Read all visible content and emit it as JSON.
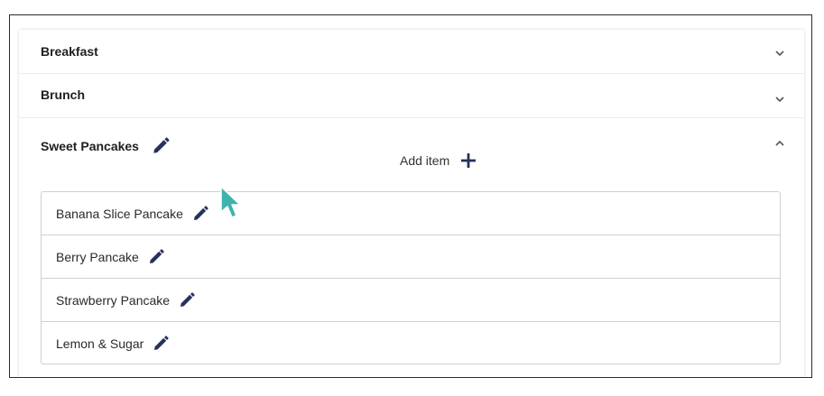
{
  "accordion": {
    "panels": [
      {
        "title": "Breakfast",
        "expanded": false
      },
      {
        "title": "Brunch",
        "expanded": false
      },
      {
        "title": "Sweet Pancakes",
        "expanded": true
      }
    ],
    "add_item_label": "Add item",
    "items": [
      {
        "label": "Banana Slice Pancake"
      },
      {
        "label": "Berry Pancake"
      },
      {
        "label": "Strawberry Pancake"
      },
      {
        "label": "Lemon & Sugar"
      }
    ]
  },
  "icons": {
    "edit": "pencil-icon",
    "add": "plus-icon",
    "collapse": "chevron-up-icon",
    "expand": "chevron-down-icon",
    "cursor": "mouse-pointer-icon"
  },
  "colors": {
    "icon_navy": "#26315e",
    "cursor_teal": "#3fb3ad",
    "text": "#212121",
    "border": "#cfcfcf"
  }
}
